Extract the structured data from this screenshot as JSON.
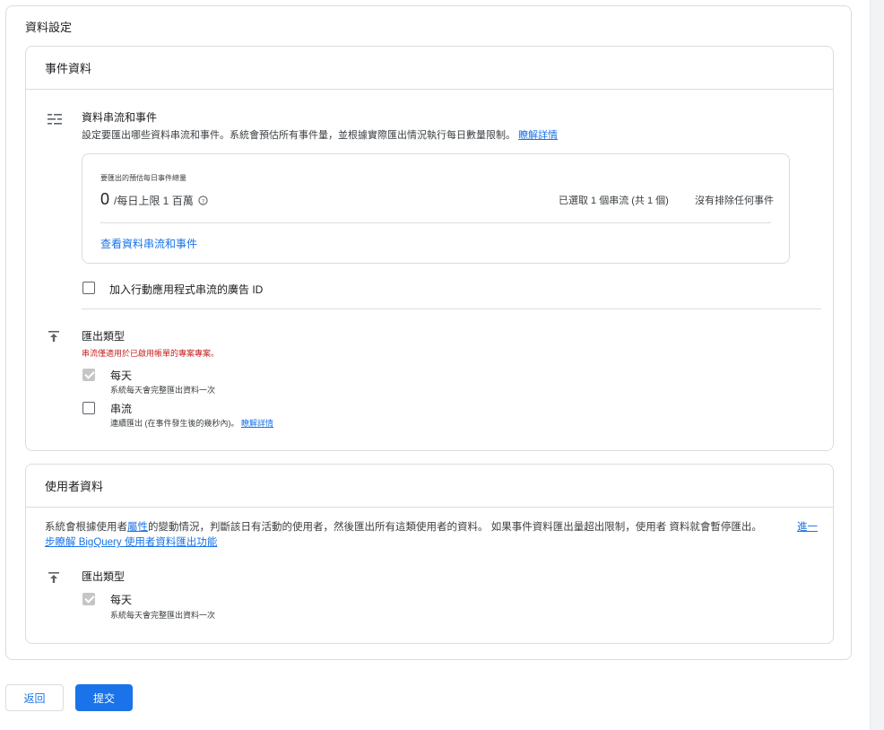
{
  "outer_title": "資料設定",
  "event_section": {
    "title": "事件資料",
    "streams": {
      "title": "資料串流和事件",
      "description": "設定要匯出哪些資料串流和事件。系統會預估所有事件量，並根據實際匯出情況執行每日數量限制。",
      "learn_more": "瞭解詳情",
      "icon": "filter-list-icon"
    },
    "estimate": {
      "label": "要匯出的預估每日事件總量",
      "value": "0",
      "limit_text": "/每日上限 1 百萬",
      "help_icon": "help-circle-icon",
      "selected_streams": "已選取 1 個串流 (共 1 個)",
      "excluded_events": "沒有排除任何事件",
      "view_link": "查看資料串流和事件"
    },
    "ad_id_checkbox": {
      "label": "加入行動應用程式串流的廣告 ID",
      "checked": false
    },
    "export_type": {
      "title": "匯出類型",
      "warning": "串流僅適用於已啟用帳單的專案專案。",
      "icon": "upload-icon",
      "options": [
        {
          "label": "每天",
          "description": "系統每天會完整匯出資料一次",
          "checked": true
        },
        {
          "label": "串流",
          "description": "連續匯出 (在事件發生後的幾秒內)。",
          "link": "瞭解詳情",
          "checked": false
        }
      ]
    }
  },
  "user_section": {
    "title": "使用者資料",
    "description_pre": "系統會根據使用者",
    "description_link": "屬性",
    "description_post": "的變動情況，判斷該日有活動的使用者，然後匯出所有這類使用者的資料。 如果事件資料匯出量超出限制，使用者 資料就會暫停匯出。",
    "learn_more_line1": "進一",
    "learn_more_line2": "步瞭解 BigQuery 使用者資料匯出功能",
    "export_type": {
      "title": "匯出類型",
      "icon": "upload-icon",
      "options": [
        {
          "label": "每天",
          "description": "系統每天會完整匯出資料一次",
          "checked": true
        }
      ]
    }
  },
  "buttons": {
    "back": "返回",
    "submit": "提交"
  },
  "colors": {
    "accent": "#1a73e8",
    "warning": "#c5221f",
    "border": "#dadce0"
  }
}
